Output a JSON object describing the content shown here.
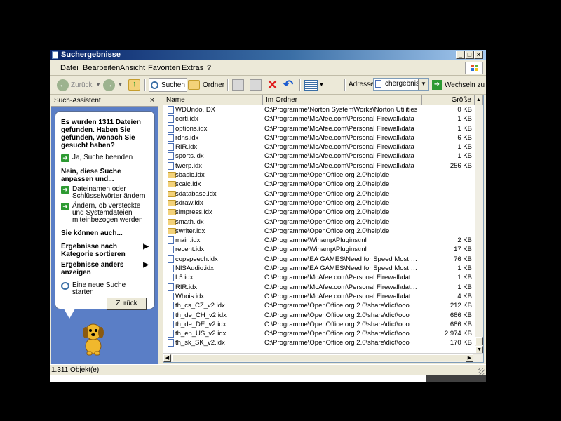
{
  "window": {
    "title": "Suchergebnisse"
  },
  "title_buttons": {
    "minimize": "_",
    "maximize": "□",
    "close": "×"
  },
  "menu": [
    "Datei",
    "Bearbeiten",
    "Ansicht",
    "Favoriten",
    "Extras",
    "?"
  ],
  "toolbar": {
    "back": "Zurück",
    "search": "Suchen",
    "folders": "Ordner",
    "address_label": "Adresse",
    "address_value": "chergebnisse",
    "go": "Wechseln zu"
  },
  "panel": {
    "title": "Such-Assistent",
    "close": "×",
    "found_text": "Es wurden 1311 Dateien gefunden. Haben Sie gefunden, wonach Sie gesucht haben?",
    "yes_option": "Ja, Suche beenden",
    "refine_heading": "Nein, diese Suche anpassen und...",
    "option_names": "Dateinamen oder Schlüsselwörter ändern",
    "option_hidden": "Ändern, ob versteckte und Systemdateien miteinbezogen werden",
    "also_heading": "Sie können auch...",
    "sort_option": "Ergebnisse nach Kategorie sortieren",
    "display_option": "Ergebnisse anders anzeigen",
    "new_search": "Eine neue Suche starten",
    "back_button": "Zurück"
  },
  "columns": {
    "name": "Name",
    "folder": "Im Ordner",
    "size": "Größe"
  },
  "rows": [
    {
      "name": "WDUndo.IDX",
      "folder": "C:\\Programme\\Norton SystemWorks\\Norton Utilities",
      "size": "0 KB",
      "icon": "file"
    },
    {
      "name": "certi.idx",
      "folder": "C:\\Programme\\McAfee.com\\Personal Firewall\\data",
      "size": "1 KB",
      "icon": "file"
    },
    {
      "name": "options.idx",
      "folder": "C:\\Programme\\McAfee.com\\Personal Firewall\\data",
      "size": "1 KB",
      "icon": "file"
    },
    {
      "name": "rdns.idx",
      "folder": "C:\\Programme\\McAfee.com\\Personal Firewall\\data",
      "size": "6 KB",
      "icon": "file"
    },
    {
      "name": "RIR.idx",
      "folder": "C:\\Programme\\McAfee.com\\Personal Firewall\\data",
      "size": "1 KB",
      "icon": "file"
    },
    {
      "name": "sports.idx",
      "folder": "C:\\Programme\\McAfee.com\\Personal Firewall\\data",
      "size": "1 KB",
      "icon": "file"
    },
    {
      "name": "twerp.idx",
      "folder": "C:\\Programme\\McAfee.com\\Personal Firewall\\data",
      "size": "256 KB",
      "icon": "file"
    },
    {
      "name": "sbasic.idx",
      "folder": "C:\\Programme\\OpenOffice.org 2.0\\help\\de",
      "size": "",
      "icon": "folder"
    },
    {
      "name": "scalc.idx",
      "folder": "C:\\Programme\\OpenOffice.org 2.0\\help\\de",
      "size": "",
      "icon": "folder"
    },
    {
      "name": "sdatabase.idx",
      "folder": "C:\\Programme\\OpenOffice.org 2.0\\help\\de",
      "size": "",
      "icon": "folder"
    },
    {
      "name": "sdraw.idx",
      "folder": "C:\\Programme\\OpenOffice.org 2.0\\help\\de",
      "size": "",
      "icon": "folder"
    },
    {
      "name": "simpress.idx",
      "folder": "C:\\Programme\\OpenOffice.org 2.0\\help\\de",
      "size": "",
      "icon": "folder"
    },
    {
      "name": "smath.idx",
      "folder": "C:\\Programme\\OpenOffice.org 2.0\\help\\de",
      "size": "",
      "icon": "folder"
    },
    {
      "name": "swriter.idx",
      "folder": "C:\\Programme\\OpenOffice.org 2.0\\help\\de",
      "size": "",
      "icon": "folder"
    },
    {
      "name": "main.idx",
      "folder": "C:\\Programme\\Winamp\\Plugins\\ml",
      "size": "2 KB",
      "icon": "file"
    },
    {
      "name": "recent.idx",
      "folder": "C:\\Programme\\Winamp\\Plugins\\ml",
      "size": "17 KB",
      "icon": "file"
    },
    {
      "name": "copspeech.idx",
      "folder": "C:\\Programme\\EA GAMES\\Need for Speed Most Wante...",
      "size": "76 KB",
      "icon": "file"
    },
    {
      "name": "NISAudio.idx",
      "folder": "C:\\Programme\\EA GAMES\\Need for Speed Most Wante...",
      "size": "1 KB",
      "icon": "file"
    },
    {
      "name": "L5.idx",
      "folder": "C:\\Programme\\McAfee.com\\Personal Firewall\\data\\mvtx",
      "size": "1 KB",
      "icon": "file"
    },
    {
      "name": "RIR.idx",
      "folder": "C:\\Programme\\McAfee.com\\Personal Firewall\\data\\mvtx",
      "size": "1 KB",
      "icon": "file"
    },
    {
      "name": "Whois.idx",
      "folder": "C:\\Programme\\McAfee.com\\Personal Firewall\\data\\mvtx",
      "size": "4 KB",
      "icon": "file"
    },
    {
      "name": "th_cs_CZ_v2.idx",
      "folder": "C:\\Programme\\OpenOffice.org 2.0\\share\\dict\\ooo",
      "size": "212 KB",
      "icon": "file"
    },
    {
      "name": "th_de_CH_v2.idx",
      "folder": "C:\\Programme\\OpenOffice.org 2.0\\share\\dict\\ooo",
      "size": "686 KB",
      "icon": "file"
    },
    {
      "name": "th_de_DE_v2.idx",
      "folder": "C:\\Programme\\OpenOffice.org 2.0\\share\\dict\\ooo",
      "size": "686 KB",
      "icon": "file"
    },
    {
      "name": "th_en_US_v2.idx",
      "folder": "C:\\Programme\\OpenOffice.org 2.0\\share\\dict\\ooo",
      "size": "2.974 KB",
      "icon": "file"
    },
    {
      "name": "th_sk_SK_v2.idx",
      "folder": "C:\\Programme\\OpenOffice.org 2.0\\share\\dict\\ooo",
      "size": "170 KB",
      "icon": "file"
    }
  ],
  "status": {
    "text": "1.311 Objekt(e)"
  },
  "colors": {
    "title_start": "#0a246a",
    "title_end": "#a6caf0",
    "panel_bg": "#5a7ec6",
    "chrome": "#ece9d8"
  }
}
